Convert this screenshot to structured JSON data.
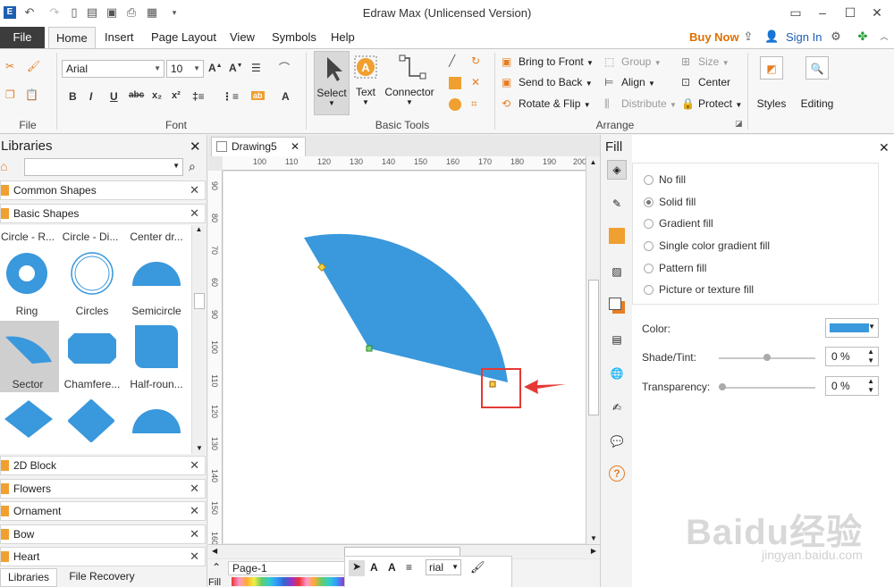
{
  "app": {
    "title": "Edraw Max (Unlicensed Version)"
  },
  "tabs": [
    "File",
    "Home",
    "Insert",
    "Page Layout",
    "View",
    "Symbols",
    "Help"
  ],
  "account": {
    "buy_now": "Buy Now",
    "sign_in": "Sign In"
  },
  "ribbon": {
    "font_name": "Arial",
    "font_size": "10",
    "groups": {
      "file": "File",
      "font": "Font",
      "basic_tools": "Basic Tools",
      "arrange": "Arrange"
    },
    "tools": {
      "select": "Select",
      "text": "Text",
      "connector": "Connector"
    },
    "arrange": {
      "bring_front": "Bring to Front",
      "send_back": "Send to Back",
      "rotate_flip": "Rotate & Flip",
      "group": "Group",
      "align": "Align",
      "distribute": "Distribute",
      "size": "Size",
      "center": "Center",
      "protect": "Protect"
    },
    "styles": "Styles",
    "editing": "Editing"
  },
  "libraries": {
    "title": "Libraries",
    "search_value": "",
    "categories_top": [
      "Common Shapes",
      "Basic Shapes"
    ],
    "shape_row_labels": [
      "Circle - R...",
      "Circle - Di...",
      "Center dr..."
    ],
    "shapes": [
      {
        "label": "Ring"
      },
      {
        "label": "Circles"
      },
      {
        "label": "Semicircle"
      },
      {
        "label": "Sector"
      },
      {
        "label": "Chamfere..."
      },
      {
        "label": "Half-roun..."
      }
    ],
    "categories_bottom": [
      "2D Block",
      "Flowers",
      "Ornament",
      "Bow",
      "Heart"
    ],
    "bottom_tabs": [
      "Libraries",
      "File Recovery"
    ]
  },
  "document": {
    "tab": "Drawing5",
    "hruler": [
      "100",
      "110",
      "120",
      "130",
      "140",
      "150",
      "160",
      "170",
      "180",
      "190",
      "200"
    ],
    "vruler": [
      "90",
      "80",
      "70",
      "60",
      "90",
      "100",
      "110",
      "120",
      "130",
      "140",
      "150",
      "160"
    ],
    "page_name": "Page-1",
    "fill_label": "Fill",
    "font_combo": "rial",
    "accent": "#3a98dc"
  },
  "fill": {
    "title": "Fill",
    "options": [
      "No fill",
      "Solid fill",
      "Gradient fill",
      "Single color gradient fill",
      "Pattern fill",
      "Picture or texture fill"
    ],
    "selected": "Solid fill",
    "color_label": "Color:",
    "color_value": "#3a98dc",
    "shade_label": "Shade/Tint:",
    "shade_value": "0 %",
    "shade_level": 0.5,
    "transparency_label": "Transparency:",
    "transparency_value": "0 %",
    "transparency_level": 0
  },
  "watermark": {
    "text": "Baidu经验",
    "url": "jingyan.baidu.com"
  }
}
